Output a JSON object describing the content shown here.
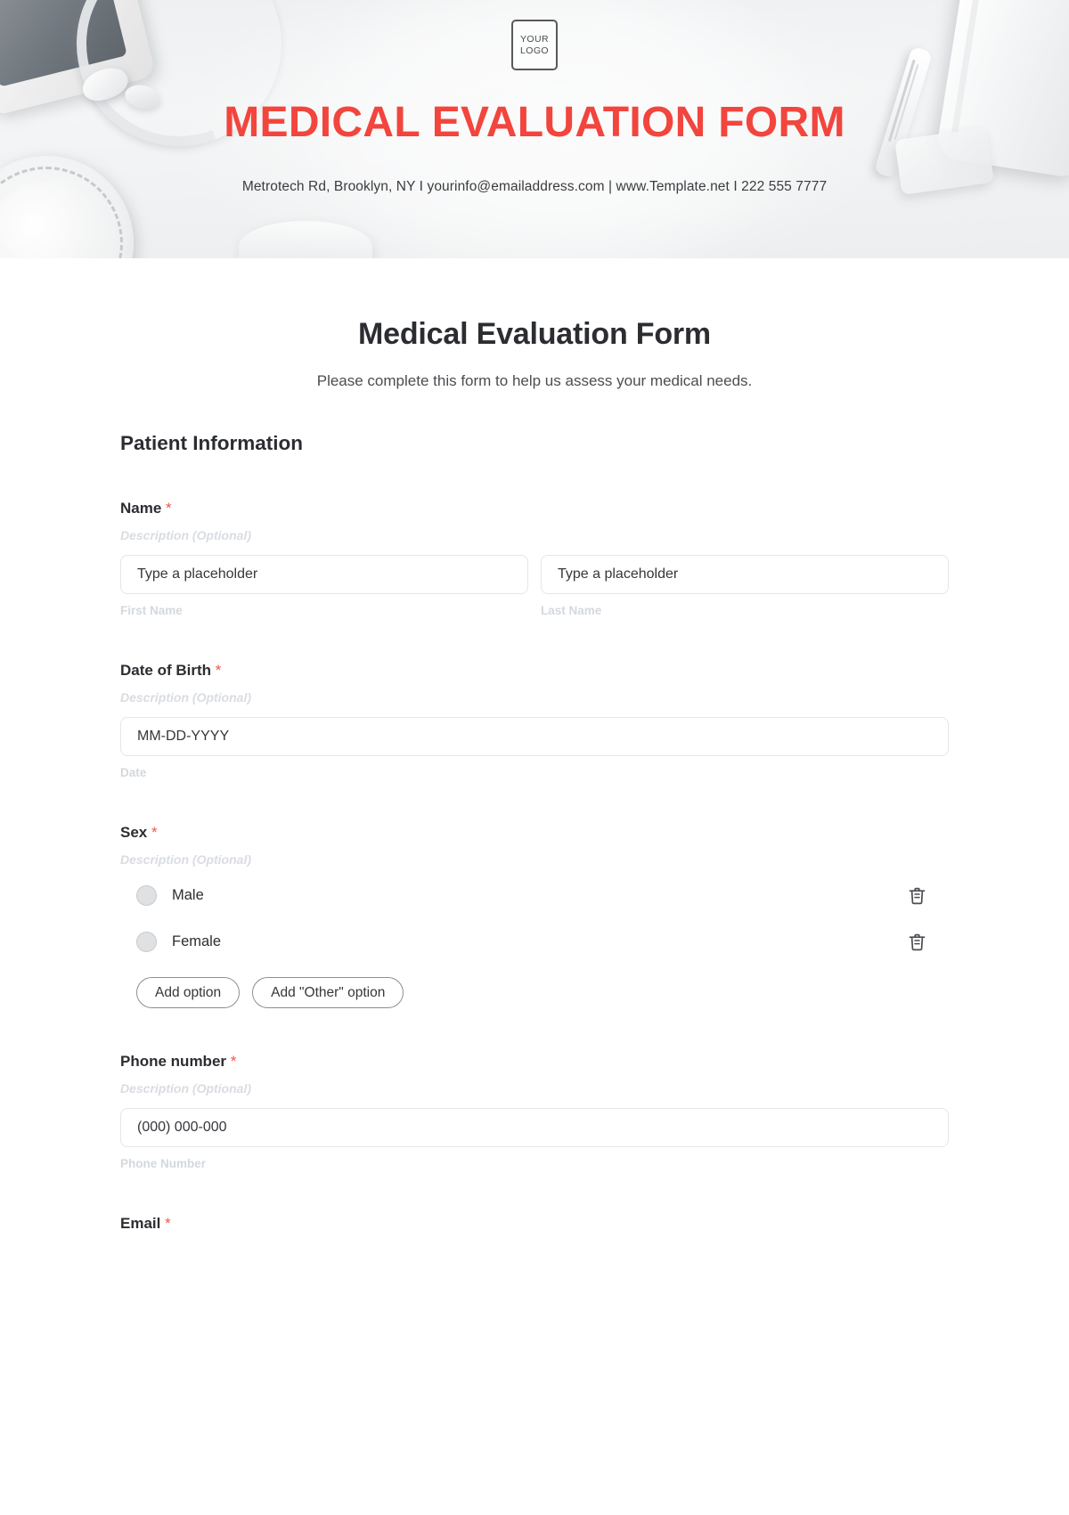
{
  "banner": {
    "logo_line1": "YOUR",
    "logo_line2": "LOGO",
    "title": "MEDICAL EVALUATION FORM",
    "contact": "Metrotech Rd, Brooklyn, NY  I  yourinfo@emailaddress.com | www.Template.net  I  222 555 7777",
    "title_color": "#f2453d"
  },
  "form": {
    "title": "Medical Evaluation Form",
    "subtitle": "Please complete this form to help us assess your medical needs.",
    "section_heading": "Patient Information",
    "required_marker": "*",
    "description_placeholder": "Description (Optional)",
    "fields": {
      "name": {
        "label": "Name",
        "description": "Description (Optional)",
        "first": {
          "placeholder": "Type a placeholder",
          "sub_label": "First Name"
        },
        "last": {
          "placeholder": "Type a placeholder",
          "sub_label": "Last Name"
        }
      },
      "dob": {
        "label": "Date of Birth",
        "description": "Description (Optional)",
        "placeholder": "MM-DD-YYYY",
        "sub_label": "Date"
      },
      "sex": {
        "label": "Sex",
        "description": "Description (Optional)",
        "options": [
          "Male",
          "Female"
        ],
        "add_option_label": "Add option",
        "add_other_label": "Add \"Other\" option"
      },
      "phone": {
        "label": "Phone number",
        "description": "Description (Optional)",
        "placeholder": "(000) 000-000",
        "sub_label": "Phone Number"
      },
      "email": {
        "label": "Email"
      }
    }
  }
}
